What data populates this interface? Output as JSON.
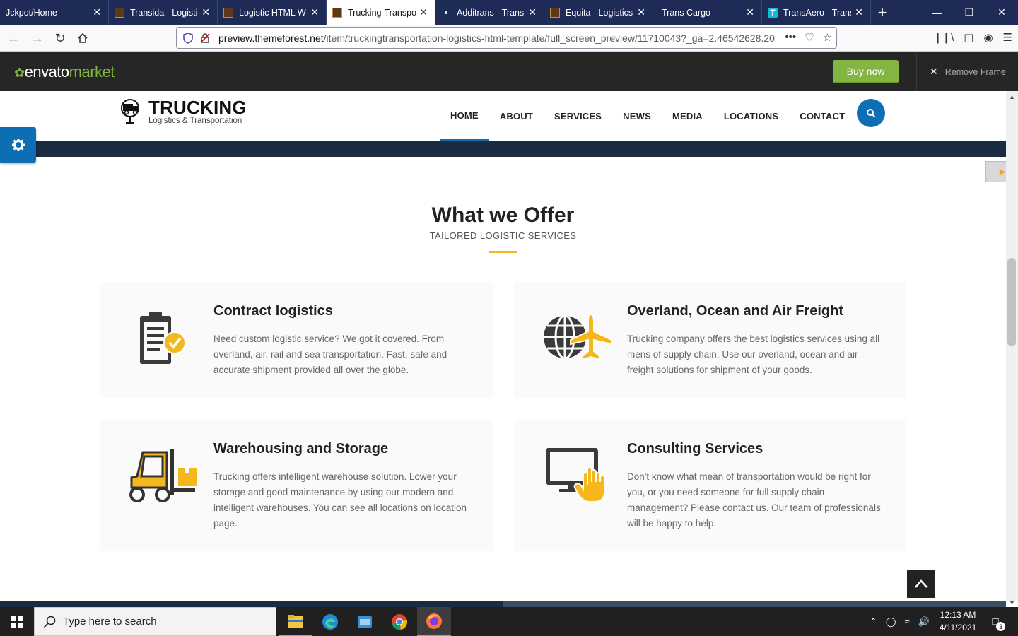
{
  "browser": {
    "tabs": [
      {
        "title": "Jckpot/Home",
        "favicon": "none"
      },
      {
        "title": "Transida - Logistic",
        "favicon": "brown"
      },
      {
        "title": "Logistic HTML W",
        "favicon": "brown"
      },
      {
        "title": "Trucking-Transpo",
        "favicon": "brown",
        "active": true
      },
      {
        "title": "Additrans - Transp",
        "favicon": "dot"
      },
      {
        "title": "Equita - Logistics",
        "favicon": "brown"
      },
      {
        "title": "Trans Cargo",
        "favicon": "none"
      },
      {
        "title": "TransAero - Transp",
        "favicon": "T"
      }
    ],
    "url_domain": "preview.themeforest.net",
    "url_path": "/item/truckingtransportation-logistics-html-template/full_screen_preview/11710043?_ga=2.46542628.20"
  },
  "envato": {
    "logo_envato": "envato",
    "logo_market": "market",
    "buy_now": "Buy now",
    "remove_frame": "Remove Frame"
  },
  "site": {
    "logo_title": "TRUCKING",
    "logo_subtitle": "Logistics & Transportation",
    "menu": [
      "HOME",
      "ABOUT",
      "SERVICES",
      "NEWS",
      "MEDIA",
      "LOCATIONS",
      "CONTACT"
    ],
    "active_menu": "HOME"
  },
  "section": {
    "title": "What we Offer",
    "subtitle": "TAILORED LOGISTIC SERVICES",
    "cards": [
      {
        "title": "Contract logistics",
        "text": "Need custom logistic service? We got it covered. From overland, air, rail and sea transportation. Fast, safe and accurate shipment provided all over the globe.",
        "icon": "clipboard-check-icon"
      },
      {
        "title": "Overland, Ocean and Air Freight",
        "text": "Trucking company offers the best logistics services using all mens of supply chain. Use our overland, ocean and air freight solutions for shipment of your goods.",
        "icon": "globe-plane-icon"
      },
      {
        "title": "Warehousing and Storage",
        "text": "Trucking offers intelligent warehouse solution. Lower your storage and good maintenance by using our modern and intelligent warehouses. You can see all locations on location page.",
        "icon": "forklift-icon"
      },
      {
        "title": "Consulting Services",
        "text": "Don't know what mean of transportation would be right for you, or you need someone for full supply chain management? Please contact us. Our team of professionals will be happy to help.",
        "icon": "monitor-hand-icon"
      }
    ]
  },
  "taskbar": {
    "search_placeholder": "Type here to search",
    "time": "12:13 AM",
    "date": "4/11/2021",
    "notifications": "3"
  },
  "colors": {
    "accent_blue": "#0d6eb4",
    "accent_yellow": "#f4b81c",
    "envato_green": "#82b541",
    "tab_bar": "#1f2b57",
    "dark_strip": "#1a2b42"
  }
}
